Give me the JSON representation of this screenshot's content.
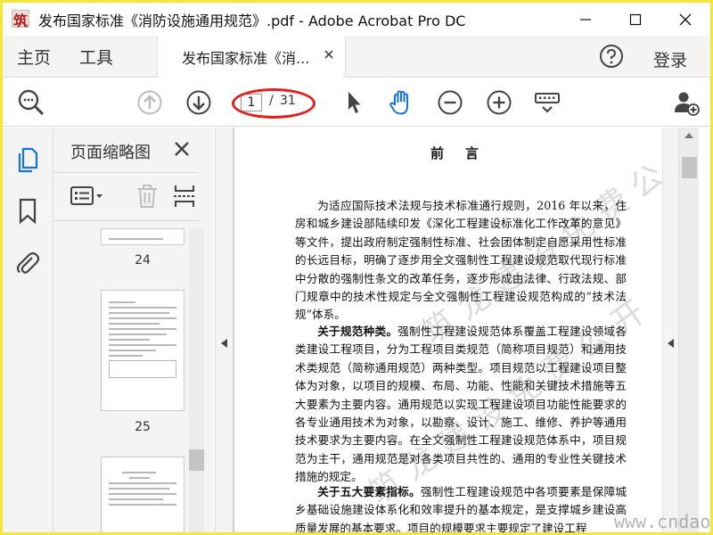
{
  "window": {
    "title": "发布国家标准《消防设施通用规范》.pdf - Adobe Acrobat Pro DC"
  },
  "tabs": {
    "home_label": "主页",
    "tools_label": "工具",
    "document_tab_label": "发布国家标准《消...",
    "login_label": "登录"
  },
  "toolbar": {
    "current_page": "1",
    "separator": "/",
    "total_pages": "31"
  },
  "thumbnails": {
    "panel_title": "页面缩略图",
    "pages": [
      {
        "number": "24"
      },
      {
        "number": "25"
      }
    ]
  },
  "document": {
    "heading": "前言",
    "paragraphs": [
      {
        "lead": "",
        "text": "为适应国际技术法规与技术标准通行规则，2016 年以来，住房和城乡建设部陆续印发《深化工程建设标准化工作改革的意见》等文件，提出政府制定强制性标准、社会团体制定自愿采用性标准的长远目标，明确了逐步用全文强制性工程建设规范取代现行标准中分散的强制性条文的改革任务，逐步形成由法律、行政法规、部门规章中的技术性规定与全文强制性工程建设规范构成的“技术法规”体系。"
      },
      {
        "lead": "关于规范种类。",
        "text": "强制性工程建设规范体系覆盖工程建设领域各类建设工程项目，分为工程项目类规范（简称项目规范）和通用技术类规范（简称通用规范）两种类型。项目规范以工程建设项目整体为对象，以项目的规模、布局、功能、性能和关键技术措施等五大要素为主要内容。通用规范以实现工程建设项目功能性能要求的各专业通用技术为对象，以勘察、设计、施工、维修、养护等通用技术要求为主要内容。在全文强制性工程建设规范体系中，项目规范为主干，通用规范是对各类项目共性的、通用的专业性关键技术措施的规定。"
      },
      {
        "lead": "关于五大要素指标。",
        "text": "强制性工程建设规范中各项要素是保障城乡基础设施建设体系化和效率提升的基本规定，是支撑城乡建设高质量发展的基本要求。项目的规模要求主要规定了建设工程"
      }
    ],
    "site_watermark": "www.cndao.com"
  },
  "colors": {
    "accent_blue": "#1473e6",
    "annotation_red": "#e0201c",
    "frame_yellow": "#f5e63a"
  }
}
